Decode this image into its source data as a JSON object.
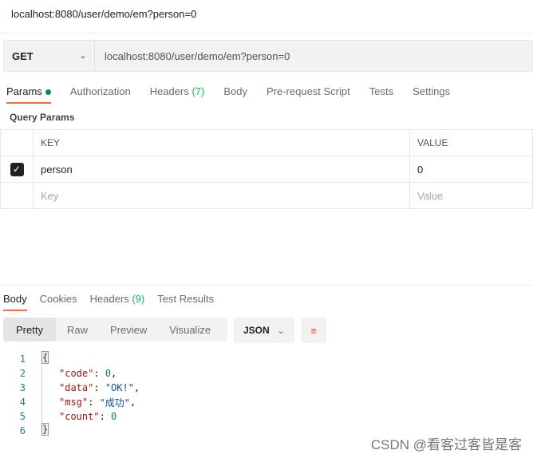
{
  "window_title": "localhost:8080/user/demo/em?person=0",
  "request": {
    "method": "GET",
    "url": "localhost:8080/user/demo/em?person=0"
  },
  "request_tabs": [
    {
      "label": "Params"
    },
    {
      "label": "Authorization"
    },
    {
      "label": "Headers",
      "count": "(7)"
    },
    {
      "label": "Body"
    },
    {
      "label": "Pre-request Script"
    },
    {
      "label": "Tests"
    },
    {
      "label": "Settings"
    }
  ],
  "query_params": {
    "title": "Query Params",
    "headers": [
      "KEY",
      "VALUE"
    ],
    "rows": [
      {
        "checked": true,
        "key": "person",
        "value": "0"
      }
    ],
    "placeholder": {
      "key": "Key",
      "value": "Value"
    }
  },
  "response_tabs": [
    {
      "label": "Body"
    },
    {
      "label": "Cookies"
    },
    {
      "label": "Headers",
      "count": "(9)"
    },
    {
      "label": "Test Results"
    }
  ],
  "view_modes": [
    "Pretty",
    "Raw",
    "Preview",
    "Visualize"
  ],
  "format": "JSON",
  "response_lines": [
    "1",
    "2",
    "3",
    "4",
    "5",
    "6"
  ],
  "response": {
    "open": "{",
    "close": "}",
    "code_key": "\"code\"",
    "code_val": "0",
    "data_key": "\"data\"",
    "data_val": "\"OK!\"",
    "msg_key": "\"msg\"",
    "msg_val": "\"成功\"",
    "count_key": "\"count\"",
    "count_val": "0"
  },
  "watermark": "CSDN @看客过客皆是客",
  "colors": {
    "accent": "#f26b3a",
    "green": "#0cbb52"
  }
}
